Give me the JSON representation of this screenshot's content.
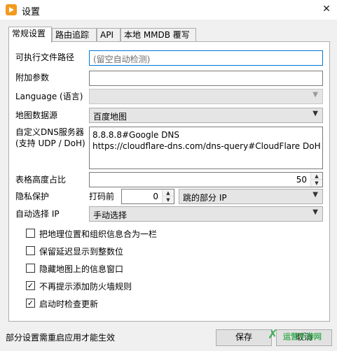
{
  "window": {
    "title": "设置",
    "close_glyph": "✕",
    "icon": "app-logo-icon"
  },
  "tabs": [
    {
      "label": "常规设置",
      "active": true
    },
    {
      "label": "路由追踪",
      "active": false
    },
    {
      "label": "API",
      "active": false
    },
    {
      "label": "本地 MMDB 覆写",
      "active": false
    }
  ],
  "form": {
    "exe_path": {
      "label": "可执行文件路径",
      "value": "",
      "placeholder": "(留空自动检测)"
    },
    "extra_args": {
      "label": "附加参数",
      "value": ""
    },
    "language": {
      "label": "Language (语言)",
      "value": ""
    },
    "map_source": {
      "label": "地图数据源",
      "value": "百度地图"
    },
    "dns": {
      "label": "自定义DNS服务器\n(支持 UDP / DoH)",
      "value": "8.8.8.8#Google DNS\nhttps://cloudflare-dns.com/dns-query#CloudFlare DoH"
    },
    "table_height": {
      "label": "表格高度占比",
      "value": "50"
    },
    "privacy": {
      "label": "隐私保护",
      "mask_label": "打码前",
      "mask_value": "0",
      "mode": "跳的部分 IP"
    },
    "auto_select_ip": {
      "label": "自动选择 IP",
      "value": "手动选择"
    }
  },
  "checkboxes": [
    {
      "label": "把地理位置和组织信息合为一栏",
      "checked": false
    },
    {
      "label": "保留延迟显示到整数位",
      "checked": false
    },
    {
      "label": "隐藏地图上的信息窗口",
      "checked": false
    },
    {
      "label": "不再提示添加防火墙规则",
      "checked": true
    },
    {
      "label": "启动时检查更新",
      "checked": true
    }
  ],
  "footer": {
    "status": "部分设置需重启应用才能生效",
    "save": "保存",
    "cancel": "取消"
  },
  "watermark": {
    "text": "运营手游网"
  },
  "colors": {
    "focus": "#0078d7",
    "accent_icon": "#f39a1e",
    "watermark": "#2ea84a"
  }
}
